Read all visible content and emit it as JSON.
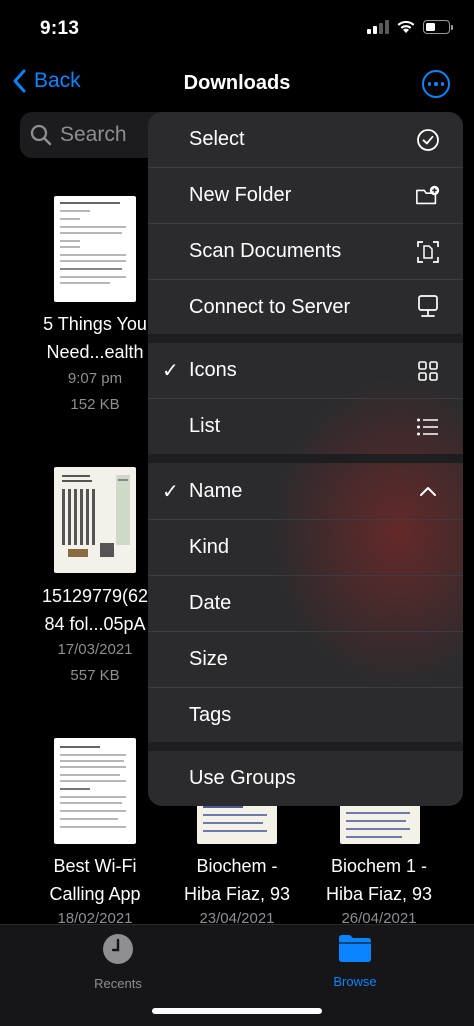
{
  "status": {
    "time": "9:13"
  },
  "nav": {
    "back_label": "Back",
    "title": "Downloads"
  },
  "search": {
    "placeholder": "Search"
  },
  "files": [
    {
      "name_line1": "5 Things You",
      "name_line2": "Need...ealth",
      "meta1": "9:07 pm",
      "meta2": "152 KB"
    },
    {
      "name_line1": "15129779(62",
      "name_line2": "84 fol...05pA",
      "meta1": "17/03/2021",
      "meta2": "557 KB"
    },
    {
      "name_line1": "Best Wi-Fi",
      "name_line2": "Calling App",
      "meta1": "18/02/2021"
    },
    {
      "name_line1": "Biochem -",
      "name_line2": "Hiba Fiaz, 93",
      "meta1": "23/04/2021"
    },
    {
      "name_line1": "Biochem 1 -",
      "name_line2": "Hiba Fiaz, 93",
      "meta1": "26/04/2021"
    }
  ],
  "menu": {
    "actions": [
      {
        "label": "Select",
        "icon": "checkmark-circle-icon"
      },
      {
        "label": "New Folder",
        "icon": "folder-plus-icon"
      },
      {
        "label": "Scan Documents",
        "icon": "document-scan-icon"
      },
      {
        "label": "Connect to Server",
        "icon": "display-server-icon"
      }
    ],
    "view": [
      {
        "label": "Icons",
        "checked": true,
        "icon": "grid-icon"
      },
      {
        "label": "List",
        "checked": false,
        "icon": "list-icon"
      }
    ],
    "sort": [
      {
        "label": "Name",
        "checked": true,
        "icon": "chevron-up-icon"
      },
      {
        "label": "Kind"
      },
      {
        "label": "Date"
      },
      {
        "label": "Size"
      },
      {
        "label": "Tags"
      }
    ],
    "groups": {
      "label": "Use Groups"
    },
    "check_glyph": "✓"
  },
  "tabbar": {
    "recents": {
      "label": "Recents"
    },
    "browse": {
      "label": "Browse"
    }
  },
  "colors": {
    "accent": "#0a84ff",
    "menu_bg": "#2b2b2d",
    "secondary_text": "#8e8e93"
  }
}
